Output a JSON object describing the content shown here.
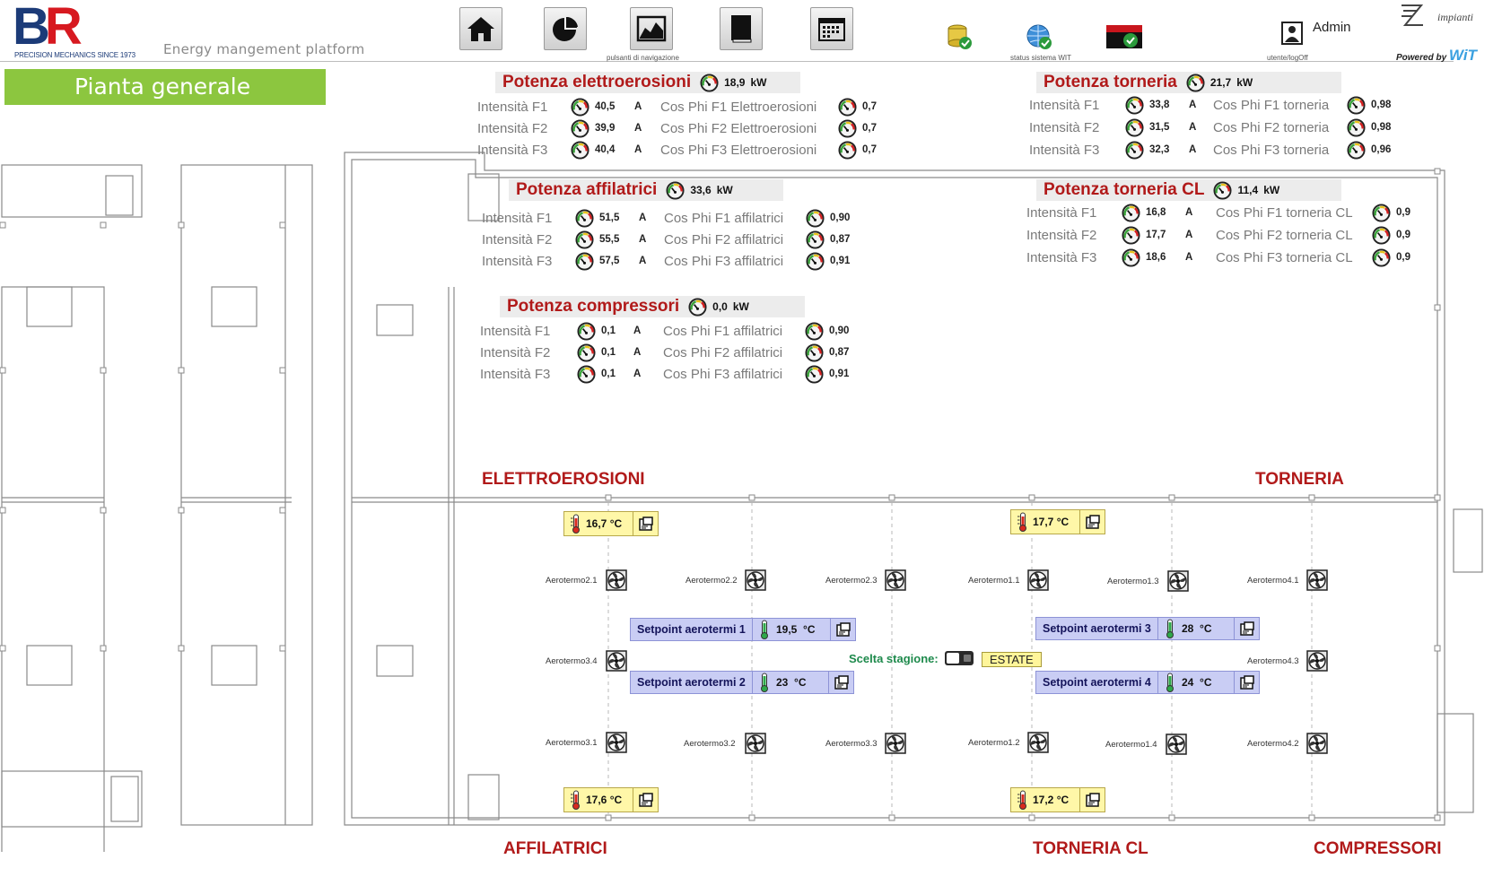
{
  "header": {
    "logo_letters_b": "B",
    "logo_letters_r": "R",
    "logo_tagline": "PRECISION MECHANICS SINCE 1973",
    "platform": "Energy mangement platform",
    "nav_caption": "pulsanti di navigazione",
    "status_caption": "status sistema WIT",
    "user_caption": "utente/logOff",
    "user_name": "Admin",
    "zimp_brand": "impianti",
    "powered_by": "Powered by",
    "powered_brand": "WiT",
    "nav_buttons": [
      "home-icon",
      "pie-chart-icon",
      "area-chart-icon",
      "book-icon",
      "calendar-icon"
    ],
    "status_icons": [
      "database-ok-icon",
      "globe-network-icon",
      "wit-server-ok-icon"
    ]
  },
  "page_title": "Pianta generale",
  "panels": {
    "elettroerosioni": {
      "title": "Potenza elettroerosioni",
      "power": "18,9",
      "unit": "kW",
      "rows": [
        {
          "label": "Intensità F1",
          "value": "40,5",
          "unit": "A",
          "cos_label": "Cos Phi F1 Elettroerosioni",
          "cos_value": "0,7"
        },
        {
          "label": "Intensità F2",
          "value": "39,9",
          "unit": "A",
          "cos_label": "Cos Phi F2 Elettroerosioni",
          "cos_value": "0,7"
        },
        {
          "label": "Intensità F3",
          "value": "40,4",
          "unit": "A",
          "cos_label": "Cos Phi F3 Elettroerosioni",
          "cos_value": "0,7"
        }
      ]
    },
    "affilatrici": {
      "title": "Potenza affilatrici",
      "power": "33,6",
      "unit": "kW",
      "rows": [
        {
          "label": "Intensità F1",
          "value": "51,5",
          "unit": "A",
          "cos_label": "Cos Phi F1 affilatrici",
          "cos_value": "0,90"
        },
        {
          "label": "Intensità F2",
          "value": "55,5",
          "unit": "A",
          "cos_label": "Cos Phi F2 affilatrici",
          "cos_value": "0,87"
        },
        {
          "label": "Intensità F3",
          "value": "57,5",
          "unit": "A",
          "cos_label": "Cos Phi F3 affilatrici",
          "cos_value": "0,91"
        }
      ]
    },
    "compressori": {
      "title": "Potenza compressori",
      "power": "0,0",
      "unit": "kW",
      "rows": [
        {
          "label": "Intensità F1",
          "value": "0,1",
          "unit": "A",
          "cos_label": "Cos Phi F1 affilatrici",
          "cos_value": "0,90"
        },
        {
          "label": "Intensità F2",
          "value": "0,1",
          "unit": "A",
          "cos_label": "Cos Phi F2 affilatrici",
          "cos_value": "0,87"
        },
        {
          "label": "Intensità F3",
          "value": "0,1",
          "unit": "A",
          "cos_label": "Cos Phi F3 affilatrici",
          "cos_value": "0,91"
        }
      ]
    },
    "torneria": {
      "title": "Potenza torneria",
      "power": "21,7",
      "unit": "kW",
      "rows": [
        {
          "label": "Intensità F1",
          "value": "33,8",
          "unit": "A",
          "cos_label": "Cos Phi F1 torneria",
          "cos_value": "0,98"
        },
        {
          "label": "Intensità F2",
          "value": "31,5",
          "unit": "A",
          "cos_label": "Cos Phi F2 torneria",
          "cos_value": "0,98"
        },
        {
          "label": "Intensità F3",
          "value": "32,3",
          "unit": "A",
          "cos_label": "Cos Phi F3 torneria",
          "cos_value": "0,96"
        }
      ]
    },
    "torneria_cl": {
      "title": "Potenza torneria CL",
      "power": "11,4",
      "unit": "kW",
      "rows": [
        {
          "label": "Intensità F1",
          "value": "16,8",
          "unit": "A",
          "cos_label": "Cos Phi F1 torneria CL",
          "cos_value": "0,9"
        },
        {
          "label": "Intensità F2",
          "value": "17,7",
          "unit": "A",
          "cos_label": "Cos Phi F2 torneria CL",
          "cos_value": "0,9"
        },
        {
          "label": "Intensità F3",
          "value": "18,6",
          "unit": "A",
          "cos_label": "Cos Phi F3 torneria CL",
          "cos_value": "0,9"
        }
      ]
    }
  },
  "zones": {
    "elettroerosioni": "ELETTROEROSIONI",
    "torneria": "TORNERIA",
    "affilatrici": "AFFILATRICI",
    "torneria_cl": "TORNERIA CL",
    "compressori": "COMPRESSORI"
  },
  "temperatures": {
    "t1": "16,7",
    "t2": "17,7",
    "t3": "17,6",
    "t4": "17,2",
    "unit": "°C"
  },
  "fans": {
    "a21": "Aerotermo2.1",
    "a22": "Aerotermo2.2",
    "a23": "Aerotermo2.3",
    "a11": "Aerotermo1.1",
    "a13": "Aerotermo1.3",
    "a41": "Aerotermo4.1",
    "a34": "Aerotermo3.4",
    "a43": "Aerotermo4.3",
    "a31": "Aerotermo3.1",
    "a32": "Aerotermo3.2",
    "a33": "Aerotermo3.3",
    "a12": "Aerotermo1.2",
    "a14": "Aerotermo1.4",
    "a42": "Aerotermo4.2"
  },
  "setpoints": {
    "s1": {
      "label": "Setpoint aerotermi 1",
      "value": "19,5",
      "unit": "°C"
    },
    "s2": {
      "label": "Setpoint aerotermi 2",
      "value": "23",
      "unit": "°C"
    },
    "s3": {
      "label": "Setpoint aerotermi 3",
      "value": "28",
      "unit": "°C"
    },
    "s4": {
      "label": "Setpoint aerotermi 4",
      "value": "24",
      "unit": "°C"
    }
  },
  "season": {
    "label": "Scelta stagione:",
    "value": "ESTATE"
  },
  "colors": {
    "title_red": "#b11a1a",
    "banner_green": "#8cc63f",
    "setpoint_blue": "#c9cdf4",
    "temp_yellow": "#fff7a8",
    "season_green": "#1e8a4c"
  }
}
